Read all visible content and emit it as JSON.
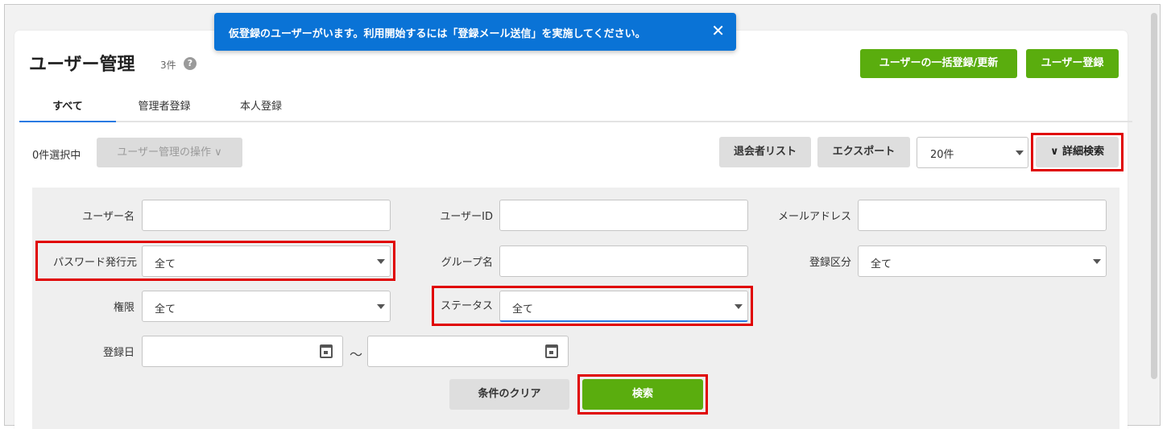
{
  "toast": {
    "message": "仮登録のユーザーがいます。利用開始するには「登録メール送信」を実施してください。",
    "close": "✕"
  },
  "header": {
    "title": "ユーザー管理",
    "count": "3件",
    "help": "?",
    "bulk_button": "ユーザーの一括登録/更新",
    "register_button": "ユーザー登録"
  },
  "tabs": [
    {
      "label": "すべて",
      "active": true
    },
    {
      "label": "管理者登録",
      "active": false
    },
    {
      "label": "本人登録",
      "active": false
    }
  ],
  "toolbar": {
    "selected": "0件選択中",
    "operations": "ユーザー管理の操作 ∨",
    "withdrawn": "退会者リスト",
    "export": "エクスポート",
    "page_size": "20件",
    "advanced_search": "∨ 詳細検索"
  },
  "filters": {
    "username_label": "ユーザー名",
    "userid_label": "ユーザーID",
    "email_label": "メールアドレス",
    "pw_issuer_label": "パスワード発行元",
    "pw_issuer_value": "全て",
    "group_label": "グループ名",
    "reg_type_label": "登録区分",
    "reg_type_value": "全て",
    "role_label": "権限",
    "role_value": "全て",
    "status_label": "ステータス",
    "status_value": "全て",
    "reg_date_label": "登録日",
    "range_sep": "〜"
  },
  "actions": {
    "clear": "条件のクリア",
    "search": "検索"
  },
  "colors": {
    "accent_green": "#5aad0e",
    "toast_blue": "#0a73d6",
    "highlight_red": "#e00000"
  }
}
